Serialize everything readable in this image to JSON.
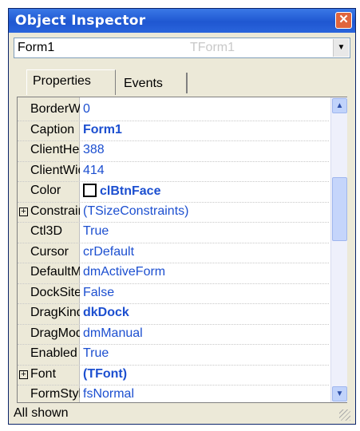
{
  "window": {
    "title": "Object Inspector"
  },
  "selector": {
    "object": "Form1",
    "class": "TForm1"
  },
  "tabs": [
    {
      "label": "Properties",
      "active": true
    },
    {
      "label": "Events",
      "active": false
    }
  ],
  "properties": [
    {
      "name": "BorderWidth",
      "value": "0",
      "style": "plain",
      "expandable": false
    },
    {
      "name": "Caption",
      "value": "Form1",
      "style": "bold",
      "expandable": false
    },
    {
      "name": "ClientHeight",
      "value": "388",
      "style": "plain",
      "expandable": false
    },
    {
      "name": "ClientWidth",
      "value": "414",
      "style": "plain",
      "expandable": false
    },
    {
      "name": "Color",
      "value": "clBtnFace",
      "style": "bold",
      "expandable": false,
      "swatch": true
    },
    {
      "name": "Constraints",
      "value": "(TSizeConstraints)",
      "style": "plain",
      "expandable": true
    },
    {
      "name": "Ctl3D",
      "value": "True",
      "style": "plain",
      "expandable": false
    },
    {
      "name": "Cursor",
      "value": "crDefault",
      "style": "plain",
      "expandable": false
    },
    {
      "name": "DefaultMonitor",
      "value": "dmActiveForm",
      "style": "plain",
      "expandable": false
    },
    {
      "name": "DockSite",
      "value": "False",
      "style": "plain",
      "expandable": false
    },
    {
      "name": "DragKind",
      "value": "dkDock",
      "style": "bold",
      "expandable": false
    },
    {
      "name": "DragMode",
      "value": "dmManual",
      "style": "plain",
      "expandable": false
    },
    {
      "name": "Enabled",
      "value": "True",
      "style": "plain",
      "expandable": false
    },
    {
      "name": "Font",
      "value": "(TFont)",
      "style": "bold",
      "expandable": true
    },
    {
      "name": "FormStyle",
      "value": "fsNormal",
      "style": "plain",
      "expandable": false
    }
  ],
  "status": {
    "text": "All shown"
  },
  "icons": {
    "close": "close-icon",
    "dropdown": "chevron-down-icon",
    "scroll_up": "chevron-up-icon",
    "scroll_down": "chevron-down-icon",
    "expand": "plus-box-icon"
  },
  "colors": {
    "title_bar": "#2a65dc",
    "value_text": "#1c4fd0",
    "panel": "#ece9d8"
  }
}
